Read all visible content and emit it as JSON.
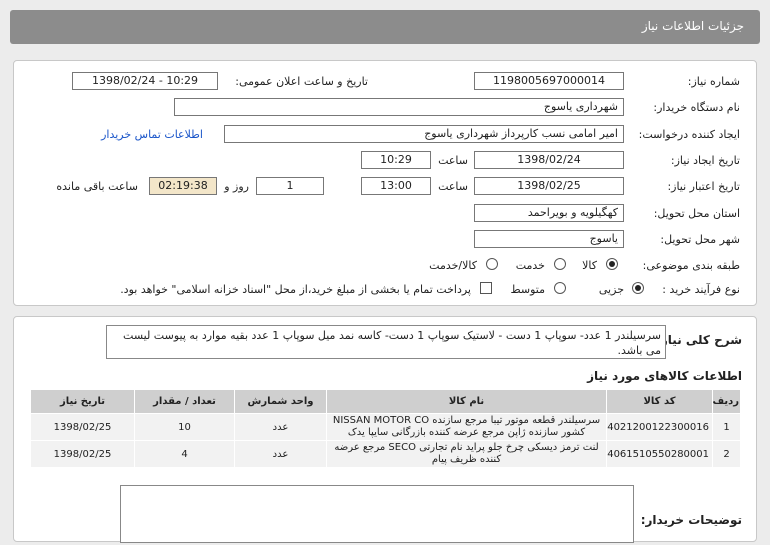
{
  "header": {
    "title": "جزئیات اطلاعات نیاز"
  },
  "form": {
    "need_number": {
      "label": "شماره نیاز:",
      "value": "1198005697000014"
    },
    "announce": {
      "label": "تاریخ و ساعت اعلان عمومی:",
      "value": "1398/02/24 - 10:29"
    },
    "buyer": {
      "label": "نام دستگاه خریدار:",
      "value": "شهرداری یاسوج"
    },
    "requester": {
      "label": "ایجاد کننده درخواست:",
      "value": "امیر امامی نسب کارپرداز شهرداری یاسوج",
      "contact_link": "اطلاعات تماس خریدار"
    },
    "created": {
      "label": "تاریخ ایجاد نیاز:",
      "date": "1398/02/24",
      "time_label": "ساعت",
      "time": "10:29"
    },
    "validity": {
      "label": "تاریخ اعتبار نیاز:",
      "date": "1398/02/25",
      "time_label": "ساعت",
      "time": "13:00",
      "days": "1",
      "days_label": "روز و",
      "remaining": "02:19:38",
      "remaining_label": "ساعت باقی مانده"
    },
    "province": {
      "label": "استان محل تحویل:",
      "value": "کهگیلویه و بویراحمد"
    },
    "city": {
      "label": "شهر محل تحویل:",
      "value": "یاسوج"
    },
    "category": {
      "label": "طبقه بندی موضوعی:",
      "options": [
        "کالا",
        "خدمت",
        "کالا/خدمت"
      ],
      "selected": "کالا"
    },
    "process": {
      "label": "نوع فرآیند خرید :",
      "options": [
        "جزیی",
        "متوسط"
      ],
      "selected": "جزیی",
      "payment_note": "پرداخت تمام یا بخشی از مبلغ خرید،از محل \"اسناد خزانه اسلامی\" خواهد بود."
    }
  },
  "summary": {
    "label": "شرح کلی نیاز:",
    "text": "سرسیلندر 1 عدد- سوپاپ 1 دست - لاستیک سوپاپ 1 دست- کاسه نمد میل سوپاپ 1 عدد بقیه موارد به پیوست لیست می باشد."
  },
  "goods": {
    "title": "اطلاعات کالاهای مورد نیاز",
    "headers": [
      "ردیف",
      "کد کالا",
      "نام کالا",
      "واحد شمارش",
      "تعداد / مقدار",
      "تاریخ نیاز"
    ],
    "rows": [
      {
        "row": "1",
        "code": "4021200122300016",
        "name": "سرسیلندر قطعه موتور تیبا مرجع سازنده NISSAN MOTOR CO کشور سازنده ژاپن مرجع عرضه کننده بازرگانی سایپا یدک",
        "unit": "عدد",
        "qty": "10",
        "date": "1398/02/25"
      },
      {
        "row": "2",
        "code": "4061510550280001",
        "name": "لنت ترمز دیسکی چرخ جلو پراید نام تجارتی SECO مرجع عرضه کننده ظریف پیام",
        "unit": "عدد",
        "qty": "4",
        "date": "1398/02/25"
      }
    ]
  },
  "buyer_notes": {
    "label": "توضیحات خریدار:",
    "value": ""
  }
}
